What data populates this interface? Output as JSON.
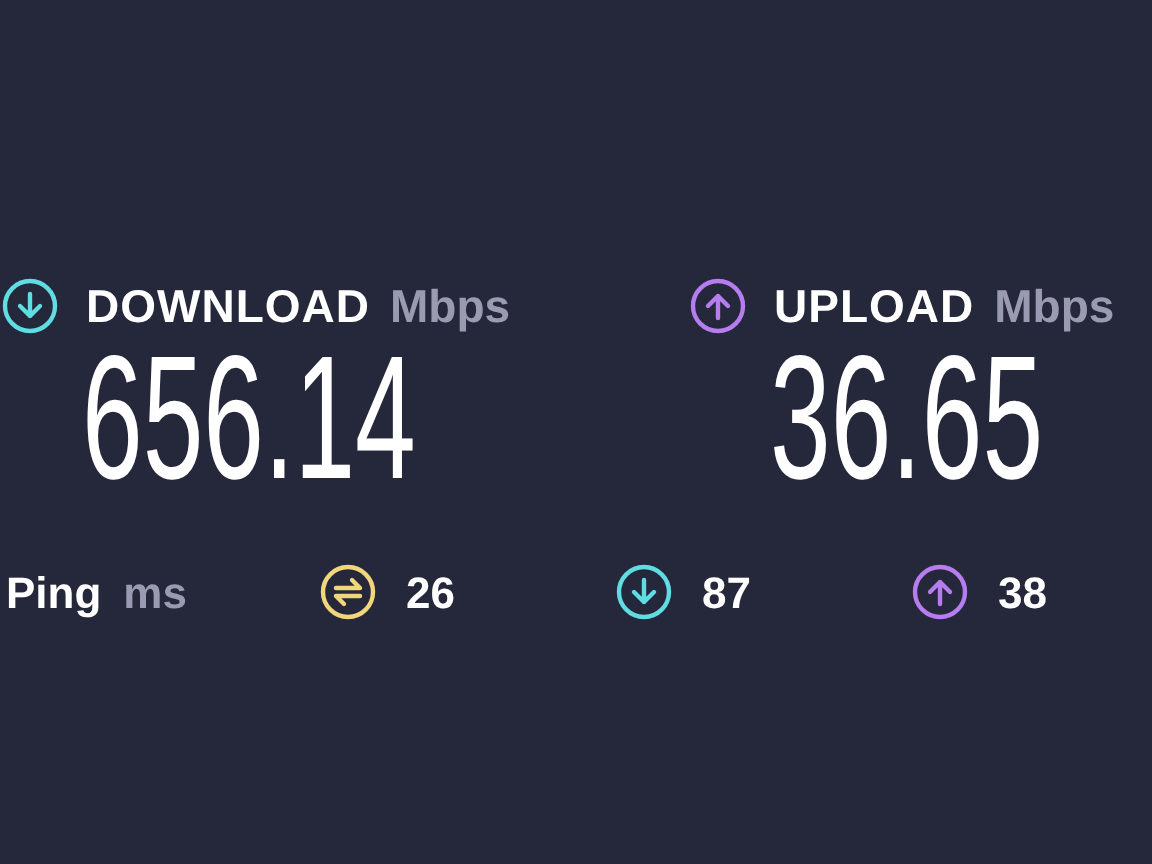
{
  "metrics": [
    {
      "kind": "down",
      "label": "DOWNLOAD",
      "unit": "Mbps",
      "value": "656.14"
    },
    {
      "kind": "up",
      "label": "UPLOAD",
      "unit": "Mbps",
      "value": "36.65"
    }
  ],
  "ping": {
    "label": "Ping",
    "unit": "ms",
    "readings": [
      {
        "kind": "idle",
        "value": "26"
      },
      {
        "kind": "down",
        "value": "87"
      },
      {
        "kind": "up",
        "value": "38"
      }
    ]
  }
}
